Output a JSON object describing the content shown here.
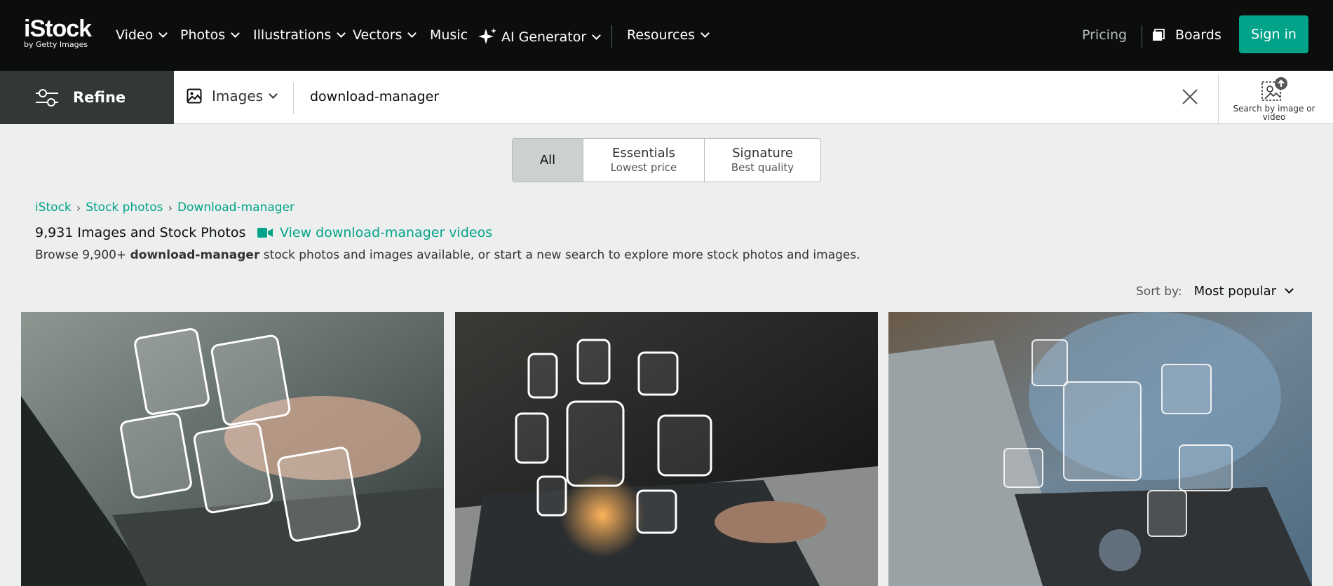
{
  "brand": {
    "name": "iStock",
    "sub": "by Getty Images"
  },
  "nav": {
    "items": [
      "Video",
      "Photos",
      "Illustrations",
      "Vectors",
      "Music",
      "AI Generator",
      "Resources"
    ],
    "pricing": "Pricing",
    "boards": "Boards",
    "sign_in": "Sign in"
  },
  "search": {
    "refine": "Refine",
    "type": "Images",
    "query": "download-manager",
    "search_by_image": "Search by image or video"
  },
  "license_tabs": [
    {
      "label": "All",
      "sub": ""
    },
    {
      "label": "Essentials",
      "sub": "Lowest price"
    },
    {
      "label": "Signature",
      "sub": "Best quality"
    }
  ],
  "breadcrumb": [
    "iStock",
    "Stock photos",
    "Download-manager"
  ],
  "results": {
    "count_label": "9,931 Images and Stock Photos",
    "video_link": "View download-manager videos",
    "browse_prefix": "Browse 9,900+ ",
    "browse_term": "download-manager",
    "browse_suffix": " stock photos and images available, or start a new search to explore more stock photos and images."
  },
  "sort": {
    "label": "Sort by:",
    "value": "Most popular"
  },
  "colors": {
    "accent": "#02a388",
    "nav_bg": "#0c0d0d",
    "refine_bg": "#333737",
    "page_bg": "#ecefee"
  }
}
